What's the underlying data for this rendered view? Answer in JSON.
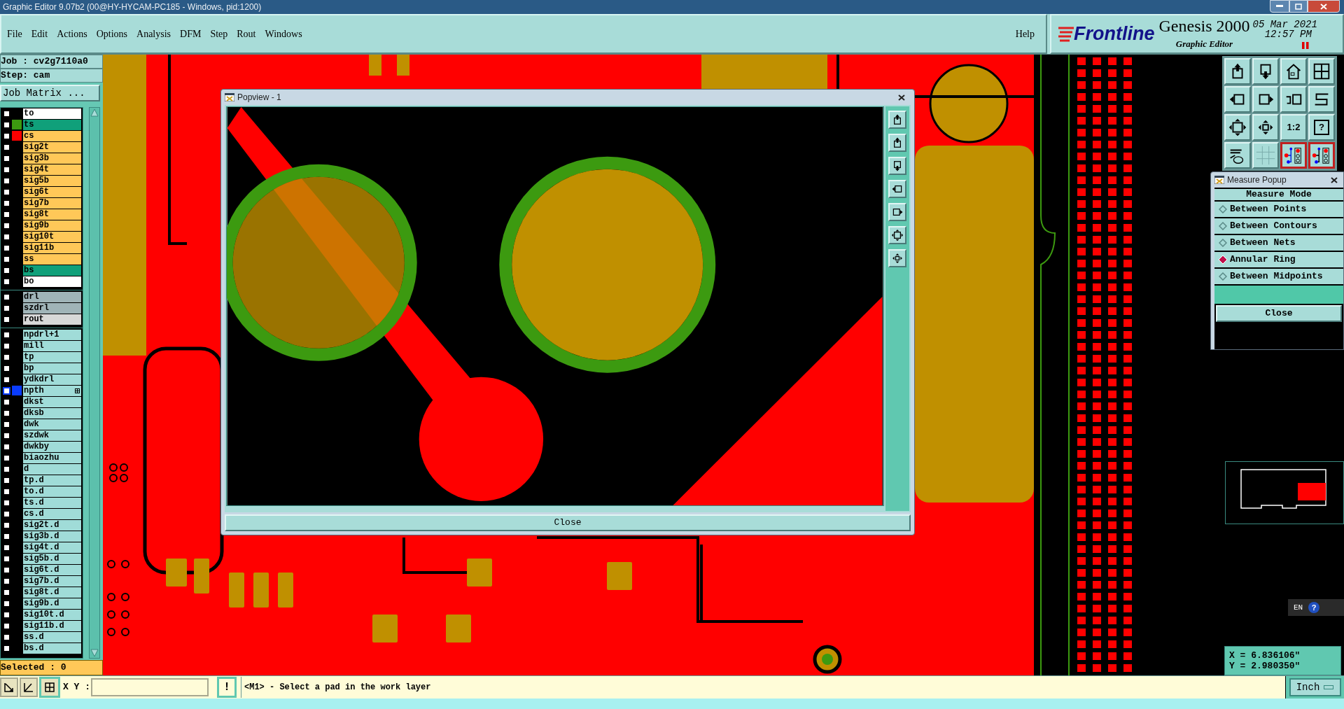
{
  "window": {
    "title": "Graphic Editor 9.07b2 (00@HY-HYCAM-PC185 - Windows, pid:1200)"
  },
  "menu": [
    "File",
    "Edit",
    "Actions",
    "Options",
    "Analysis",
    "DFM",
    "Step",
    "Rout",
    "Windows"
  ],
  "help": "Help",
  "brand": {
    "logo": "Frontline",
    "product": "Genesis 2000",
    "subtitle": "Graphic Editor",
    "date": "05 Mar 2021",
    "time": "12:57 PM"
  },
  "job": {
    "job": "Job : cv2g7110a0",
    "step": "Step: cam",
    "matrix_button": "Job Matrix ..."
  },
  "layer_groups": [
    [
      {
        "name": "to",
        "kind": "silk",
        "checked": false
      },
      {
        "name": "ts",
        "kind": "mask",
        "checked": false,
        "color": "#3c9a10"
      },
      {
        "name": "cs",
        "kind": "signal",
        "checked": false,
        "color": "#ff0000"
      },
      {
        "name": "sig2t",
        "kind": "signal",
        "checked": false
      },
      {
        "name": "sig3b",
        "kind": "signal",
        "checked": false
      },
      {
        "name": "sig4t",
        "kind": "signal",
        "checked": false
      },
      {
        "name": "sig5b",
        "kind": "signal",
        "checked": false
      },
      {
        "name": "sig6t",
        "kind": "signal",
        "checked": false
      },
      {
        "name": "sig7b",
        "kind": "signal",
        "checked": false
      },
      {
        "name": "sig8t",
        "kind": "signal",
        "checked": false
      },
      {
        "name": "sig9b",
        "kind": "signal",
        "checked": false
      },
      {
        "name": "sig10t",
        "kind": "signal",
        "checked": false
      },
      {
        "name": "sig11b",
        "kind": "signal",
        "checked": false
      },
      {
        "name": "ss",
        "kind": "signal",
        "checked": false
      },
      {
        "name": "bs",
        "kind": "mask",
        "checked": false
      },
      {
        "name": "bo",
        "kind": "silk",
        "checked": false
      }
    ],
    [
      {
        "name": "drl",
        "kind": "drill",
        "checked": false
      },
      {
        "name": "szdrl",
        "kind": "drill",
        "checked": false
      },
      {
        "name": "rout",
        "kind": "rout",
        "checked": false
      }
    ],
    [
      {
        "name": "npdrl+1",
        "kind": "misc",
        "checked": false
      },
      {
        "name": "mill",
        "kind": "misc",
        "checked": false
      },
      {
        "name": "tp",
        "kind": "misc",
        "checked": false
      },
      {
        "name": "bp",
        "kind": "misc",
        "checked": false
      },
      {
        "name": "ydkdrl",
        "kind": "misc",
        "checked": false
      },
      {
        "name": "npth",
        "kind": "misc",
        "checked": false,
        "color": "#0a3cff",
        "marker": true
      },
      {
        "name": "dkst",
        "kind": "misc",
        "checked": false
      },
      {
        "name": "dksb",
        "kind": "misc",
        "checked": false
      },
      {
        "name": "dwk",
        "kind": "misc",
        "checked": false
      },
      {
        "name": "szdwk",
        "kind": "misc",
        "checked": false
      },
      {
        "name": "dwkby",
        "kind": "misc",
        "checked": false
      },
      {
        "name": "biaozhu",
        "kind": "misc",
        "checked": false
      },
      {
        "name": "d",
        "kind": "misc",
        "checked": false
      },
      {
        "name": "tp.d",
        "kind": "misc",
        "checked": false
      },
      {
        "name": "to.d",
        "kind": "misc",
        "checked": false
      },
      {
        "name": "ts.d",
        "kind": "misc",
        "checked": false
      },
      {
        "name": "cs.d",
        "kind": "misc",
        "checked": false
      },
      {
        "name": "sig2t.d",
        "kind": "misc",
        "checked": false
      },
      {
        "name": "sig3b.d",
        "kind": "misc",
        "checked": false
      },
      {
        "name": "sig4t.d",
        "kind": "misc",
        "checked": false
      },
      {
        "name": "sig5b.d",
        "kind": "misc",
        "checked": false
      },
      {
        "name": "sig6t.d",
        "kind": "misc",
        "checked": false
      },
      {
        "name": "sig7b.d",
        "kind": "misc",
        "checked": false
      },
      {
        "name": "sig8t.d",
        "kind": "misc",
        "checked": false
      },
      {
        "name": "sig9b.d",
        "kind": "misc",
        "checked": false
      },
      {
        "name": "sig10t.d",
        "kind": "misc",
        "checked": false
      },
      {
        "name": "sig11b.d",
        "kind": "misc",
        "checked": false
      },
      {
        "name": "ss.d",
        "kind": "misc",
        "checked": false
      },
      {
        "name": "bs.d",
        "kind": "misc",
        "checked": false
      }
    ]
  ],
  "selected_count": "Selected : 0",
  "toolbar": {
    "ratio": "1:2",
    "help": "?",
    "net_tools": [
      {
        "selected": true
      },
      {
        "selected": true
      }
    ]
  },
  "popview": {
    "title": "Popview - 1",
    "close": "Close"
  },
  "measure_popup": {
    "title": "Measure Popup",
    "heading": "Measure Mode",
    "modes": [
      {
        "label": "Between Points",
        "selected": false
      },
      {
        "label": "Between Contours",
        "selected": false
      },
      {
        "label": "Between Nets",
        "selected": false
      },
      {
        "label": "Annular Ring",
        "selected": true
      },
      {
        "label": "Between Midpoints",
        "selected": false
      }
    ],
    "close": "Close"
  },
  "language_bar": {
    "code": "EN",
    "help": "?"
  },
  "coordinates": {
    "x": "X = 6.836106\"",
    "y": "Y = 2.980350\""
  },
  "command_bar": {
    "label": "X Y :",
    "alert": "!",
    "message": "<M1> - Select a pad in the work layer",
    "units": "Inch"
  }
}
